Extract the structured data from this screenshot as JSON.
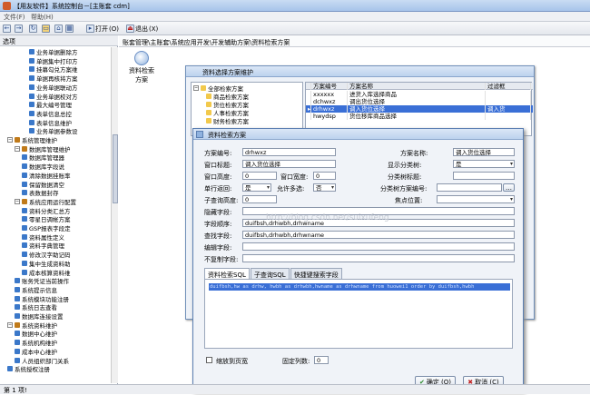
{
  "window": {
    "title": "【用友软件】系统控制台－[主账套 cdm]"
  },
  "menu": [
    "文件(F)",
    "帮助(H)"
  ],
  "toolbar": {
    "open": "打开",
    "exit": "退出"
  },
  "sidebar": {
    "header": "选项",
    "items": [
      {
        "label": "业务单据删除方",
        "indent": 4,
        "color": "#3b78c9"
      },
      {
        "label": "单据集中打印方",
        "indent": 4,
        "color": "#3b78c9"
      },
      {
        "label": "挂幕勾兑方案维",
        "indent": 4,
        "color": "#3b78c9"
      },
      {
        "label": "单据再核将方案",
        "indent": 4,
        "color": "#3b78c9"
      },
      {
        "label": "业务单据联动方",
        "indent": 4,
        "color": "#3b78c9"
      },
      {
        "label": "业务单据校对方",
        "indent": 4,
        "color": "#3b78c9"
      },
      {
        "label": "最大编号管理",
        "indent": 4,
        "color": "#3b78c9"
      },
      {
        "label": "表单信息总控",
        "indent": 4,
        "color": "#3b78c9"
      },
      {
        "label": "表单信息维护",
        "indent": 4,
        "color": "#3b78c9"
      },
      {
        "label": "业务单据参数设",
        "indent": 4,
        "color": "#3b78c9"
      },
      {
        "label": "系统管理维护",
        "indent": 1,
        "color": "#c07a1a"
      },
      {
        "label": "数据库管理维护",
        "indent": 2,
        "color": "#c07a1a"
      },
      {
        "label": "数据库管理器",
        "indent": 3,
        "color": "#3b78c9"
      },
      {
        "label": "数据库字段说",
        "indent": 3,
        "color": "#3b78c9"
      },
      {
        "label": "清除数据挂账率",
        "indent": 3,
        "color": "#3b78c9"
      },
      {
        "label": "保留数据清空",
        "indent": 3,
        "color": "#3b78c9"
      },
      {
        "label": "表数据封存",
        "indent": 3,
        "color": "#3b78c9"
      },
      {
        "label": "系统应用运行配置",
        "indent": 2,
        "color": "#c07a1a"
      },
      {
        "label": "资料分类汇总方",
        "indent": 3,
        "color": "#3b78c9"
      },
      {
        "label": "零星日调帐方案",
        "indent": 3,
        "color": "#3b78c9"
      },
      {
        "label": "GSP报表字段定",
        "indent": 3,
        "color": "#3b78c9"
      },
      {
        "label": "资料属性定义",
        "indent": 3,
        "color": "#3b78c9"
      },
      {
        "label": "资料字典管理",
        "indent": 3,
        "color": "#3b78c9"
      },
      {
        "label": "修改汉字助记码",
        "indent": 3,
        "color": "#3b78c9"
      },
      {
        "label": "集中生成资料助",
        "indent": 3,
        "color": "#3b78c9"
      },
      {
        "label": "成本核算资料维",
        "indent": 3,
        "color": "#3b78c9"
      },
      {
        "label": "账务凭证当前操作",
        "indent": 2,
        "color": "#3b78c9"
      },
      {
        "label": "系统提示信息",
        "indent": 2,
        "color": "#3b78c9"
      },
      {
        "label": "系统模块功能注册",
        "indent": 2,
        "color": "#3b78c9"
      },
      {
        "label": "系统日志查看",
        "indent": 2,
        "color": "#3b78c9"
      },
      {
        "label": "数据库连接设置",
        "indent": 2,
        "color": "#3b78c9"
      },
      {
        "label": "系统资料维护",
        "indent": 1,
        "color": "#c07a1a"
      },
      {
        "label": "数据中心维护",
        "indent": 2,
        "color": "#3b78c9"
      },
      {
        "label": "系统机构维护",
        "indent": 2,
        "color": "#3b78c9"
      },
      {
        "label": "成本中心维护",
        "indent": 2,
        "color": "#3b78c9"
      },
      {
        "label": "人员组织部门关系",
        "indent": 2,
        "color": "#3b78c9"
      },
      {
        "label": "系统授权注册",
        "indent": 1,
        "color": "#3b78c9"
      }
    ]
  },
  "breadcrumb": "账套管理\\主账套\\系统应用开发\\开发辅助方案\\资料检索方案",
  "desktop_icon": "资料检索方案",
  "dialog_outer": {
    "title": "资料选择方案维护",
    "tree": {
      "root": "全部检索方案",
      "children": [
        "商品检索方案",
        "货位检索方案",
        "人事检索方案",
        "财务检索方案"
      ]
    },
    "grid": {
      "headers": [
        "方案编号",
        "方案名称",
        "过滤框"
      ],
      "rows": [
        {
          "code": "xxxxxx",
          "name": "进货入库选择商品",
          "filter": "",
          "selected": false
        },
        {
          "code": "dchwxz",
          "name": "调出货位选择",
          "filter": "",
          "selected": false
        },
        {
          "code": "drhwxz",
          "name": "调入货位选择",
          "filter": "调入货",
          "selected": true
        },
        {
          "code": "hwydsp",
          "name": "货位移库商品选择",
          "filter": "",
          "selected": false
        }
      ]
    }
  },
  "dialog_inner": {
    "title": "资料检索方案",
    "fields": {
      "scheme_code_label": "方案编号:",
      "scheme_code": "drhwxz",
      "scheme_name_label": "方案名称:",
      "scheme_name": "调入货位选择",
      "window_title_label": "窗口标题:",
      "window_title": "调入货位选择",
      "show_category_label": "显示分类树:",
      "show_category": "是",
      "window_height_label": "窗口高度:",
      "window_height": "0",
      "window_width_label": "窗口宽度:",
      "window_width": "0",
      "category_field_label": "分类树标题:",
      "category_field": "",
      "single_return_label": "单行返回:",
      "single_return": "是",
      "allow_multi_label": "允许多选:",
      "allow_multi": "否",
      "category_scheme_label": "分类树方案编号:",
      "category_scheme": "",
      "sub_height_label": "子查询高度:",
      "sub_height": "0",
      "focus_label": "焦点位置:",
      "focus": "",
      "hidden_label": "隐藏字段:",
      "hidden": "",
      "order_label": "字段顺序:",
      "order": "duifbsh,drhwbh,drhwname",
      "search_label": "查找字段:",
      "search": "duifbsh,drhwbh,drhwname",
      "edit_label": "编辑字段:",
      "edit": "",
      "nocopy_label": "不复制字段:",
      "nocopy": ""
    },
    "tabs": [
      "资料检索SQL",
      "子查询SQL",
      "快捷键搜索字段"
    ],
    "sql": "duifbsh,hw as drhw, hwbh as drhwbh,hwname as drhwname from huowei1 order by duifbsh,hwbh",
    "adjust_label": "缩放到页宽",
    "fixed_cols_label": "固定列数:",
    "fixed_cols": "0",
    "ok": "确定 (O)",
    "cancel": "取消 (C)"
  },
  "watermark": "http://blog.csdn.net/suixufeng",
  "status": "第 1 项!"
}
